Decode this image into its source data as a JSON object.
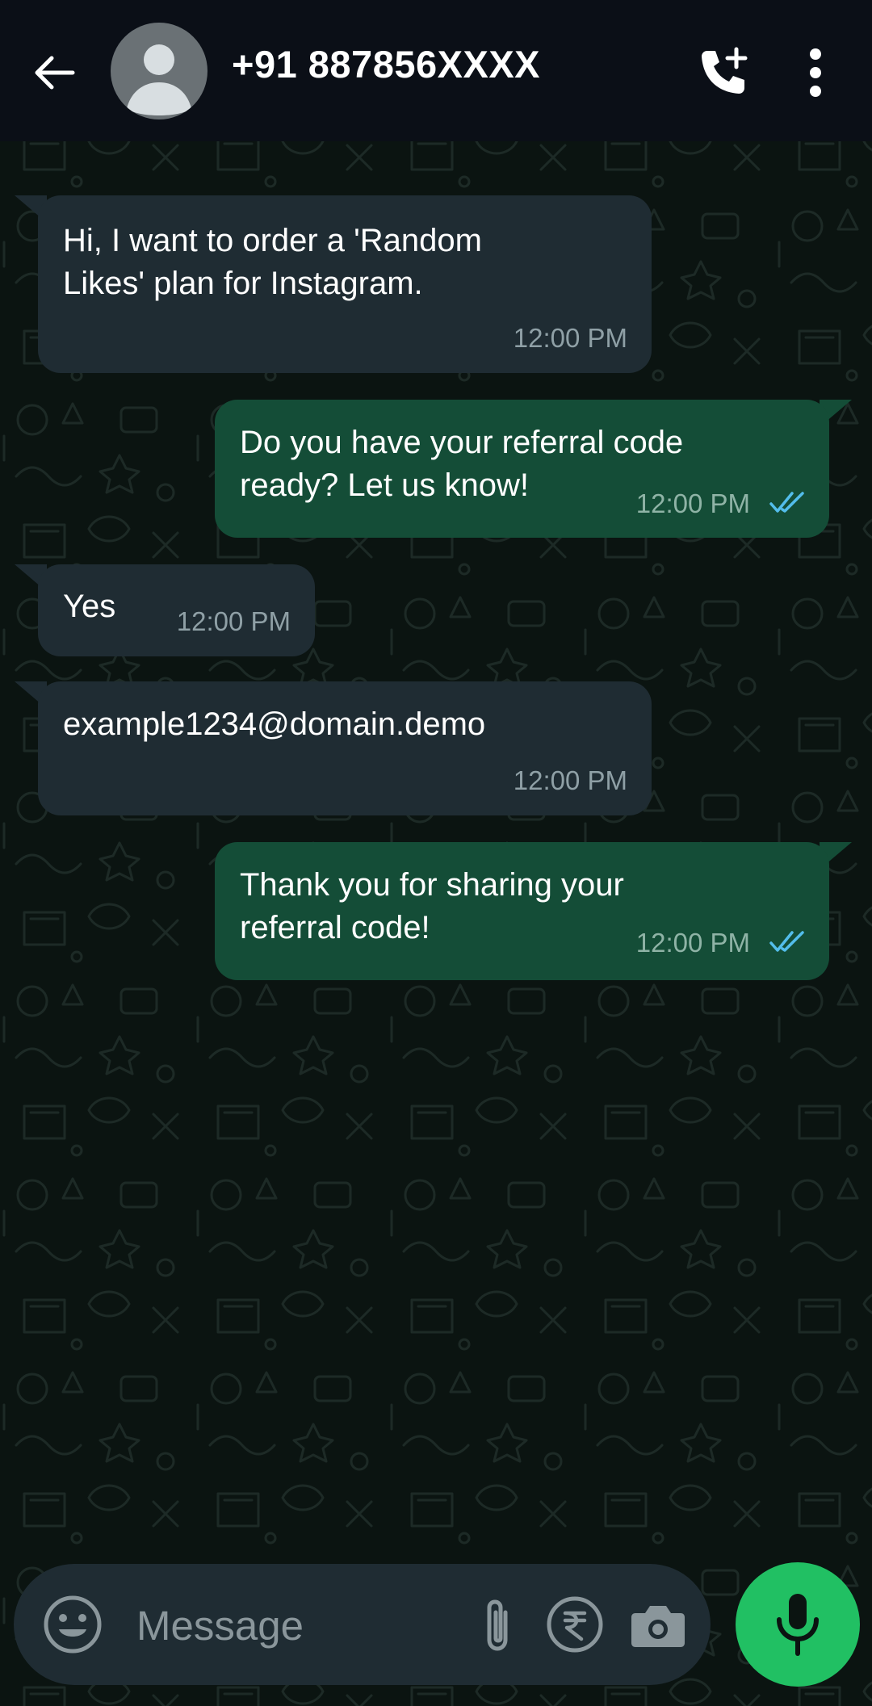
{
  "header": {
    "contact_name": "+91 887856XXXX",
    "back_icon": "arrow-left-icon",
    "avatar_icon": "default-avatar-icon",
    "call_icon": "add-call-icon",
    "menu_icon": "more-vertical-icon",
    "background_color": "#0b0f17"
  },
  "messages": [
    {
      "direction": "incoming",
      "lines": [
        "Hi, I want to order a 'Random",
        "Likes' plan for Instagram."
      ],
      "time": "12:00 PM"
    },
    {
      "direction": "outgoing",
      "lines": [
        "Do you have your referral code",
        "ready? Let us know!"
      ],
      "time": "12:00 PM",
      "status": "read"
    },
    {
      "direction": "incoming",
      "lines": [
        "Yes"
      ],
      "time": "12:00 PM"
    },
    {
      "direction": "incoming",
      "lines": [
        "example1234@domain.demo"
      ],
      "time": "12:00 PM"
    },
    {
      "direction": "outgoing",
      "lines": [
        "Thank you for sharing your",
        "referral code!"
      ],
      "time": "12:00 PM",
      "status": "read"
    }
  ],
  "composer": {
    "placeholder": "Message",
    "emoji_icon": "emoji-icon",
    "attach_icon": "paperclip-icon",
    "payment_icon": "rupee-icon",
    "camera_icon": "camera-icon",
    "mic_icon": "microphone-icon"
  },
  "colors": {
    "incoming_bubble": "#1f2c33",
    "outgoing_bubble": "#144d37",
    "read_ticks": "#53bdeb",
    "mic_button": "#21c063",
    "chat_background": "#0b1411"
  }
}
